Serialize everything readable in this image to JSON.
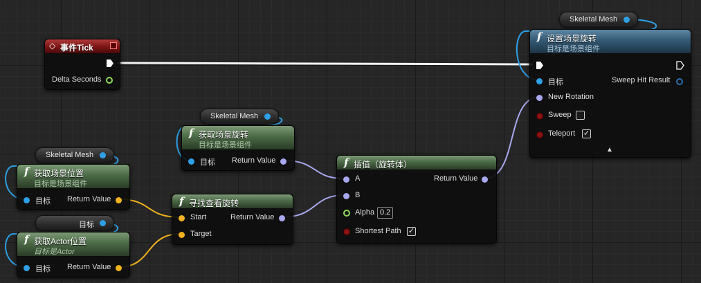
{
  "colors": {
    "pin_object": "#2ea0e6",
    "pin_rotator": "#a8a8f0",
    "pin_vector": "#f0b21e",
    "pin_float": "#8fdc5a",
    "pin_bool": "#8a1212",
    "pure_header": "#4b6a46",
    "impure_header": "#345a74",
    "event_header": "#7a1414"
  },
  "tick_node": {
    "title": "事件Tick",
    "delta_seconds": "Delta Seconds"
  },
  "skeletal_mesh_1": {
    "label": "Skeletal Mesh"
  },
  "skeletal_mesh_2": {
    "label": "Skeletal Mesh"
  },
  "skeletal_mesh_3": {
    "label": "Skeletal Mesh"
  },
  "self_target_var": {
    "label": "目标"
  },
  "set_rotation": {
    "title": "设置场景旋转",
    "subtitle": "目标是场景组件",
    "target": "目标",
    "new_rotation": "New Rotation",
    "sweep": "Sweep",
    "teleport": "Teleport",
    "sweep_hit_result": "Sweep Hit Result",
    "sweep_checked": "",
    "teleport_checked": "✓",
    "expand_arrow": "▲"
  },
  "get_rotation": {
    "title": "获取场景旋转",
    "subtitle": "目标是场景组件",
    "target": "目标",
    "return_value": "Return Value"
  },
  "get_location": {
    "title": "获取场景位置",
    "subtitle": "目标是场景组件",
    "target": "目标",
    "return_value": "Return Value"
  },
  "get_actor_location": {
    "title": "获取Actor位置",
    "subtitle": "目标是Actor",
    "target": "目标",
    "return_value": "Return Value"
  },
  "find_look_at": {
    "title": "寻找查看旋转",
    "start": "Start",
    "target": "Target",
    "return_value": "Return Value"
  },
  "interp": {
    "title": "插值（旋转体）",
    "a": "A",
    "b": "B",
    "alpha_label": "Alpha",
    "alpha_value": "0.2",
    "shortest_path": "Shortest Path",
    "shortest_path_checked": "✓",
    "return_value": "Return Value"
  }
}
